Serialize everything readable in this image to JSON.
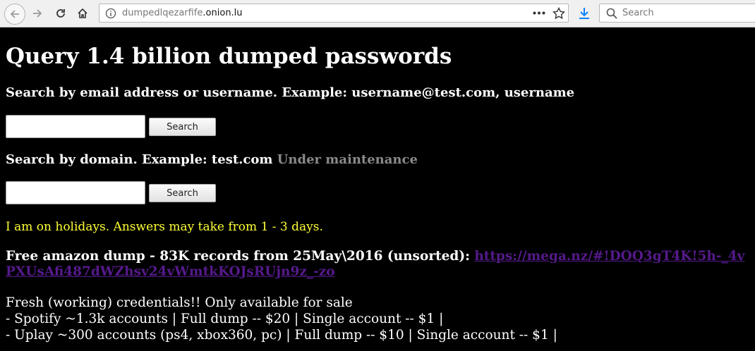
{
  "browser": {
    "url_prefix": "dumpedlqezarfife",
    "url_domain": ".onion.lu",
    "search_placeholder": "Search"
  },
  "page": {
    "title": "Query 1.4 billion dumped passwords",
    "search_user_label": "Search by email address or username. Example: username@test.com, username",
    "search_user_button": "Search",
    "search_domain_label": "Search by domain. Example: test.com",
    "maintenance_text": "Under maintenance",
    "search_domain_button": "Search",
    "holiday_notice": "I am on holidays. Answers may take from 1 - 3 days.",
    "amazon_text": "Free amazon dump - 83K records from 25May\\2016 (unsorted):",
    "amazon_link": "https://mega.nz/#!DOQ3gT4K!5h-_4vPXUsAfi487dWZhsv24vWmtkKOJsRUjn9z_-zo",
    "fresh_title": "Fresh (working) credentials!! Only available for sale",
    "fresh_line1": "- Spotify ~1.3k accounts | Full dump -- $20 | Single account -- $1 |",
    "fresh_line2": "- Uplay ~300 accounts (ps4, xbox360, pc) | Full dump -- $10 | Single account -- $1 |"
  },
  "colors": {
    "background": "#000000",
    "text": "#ffffff",
    "holiday": "#ffff33",
    "link": "#551a8b",
    "maintenance": "#8a8a8a"
  }
}
